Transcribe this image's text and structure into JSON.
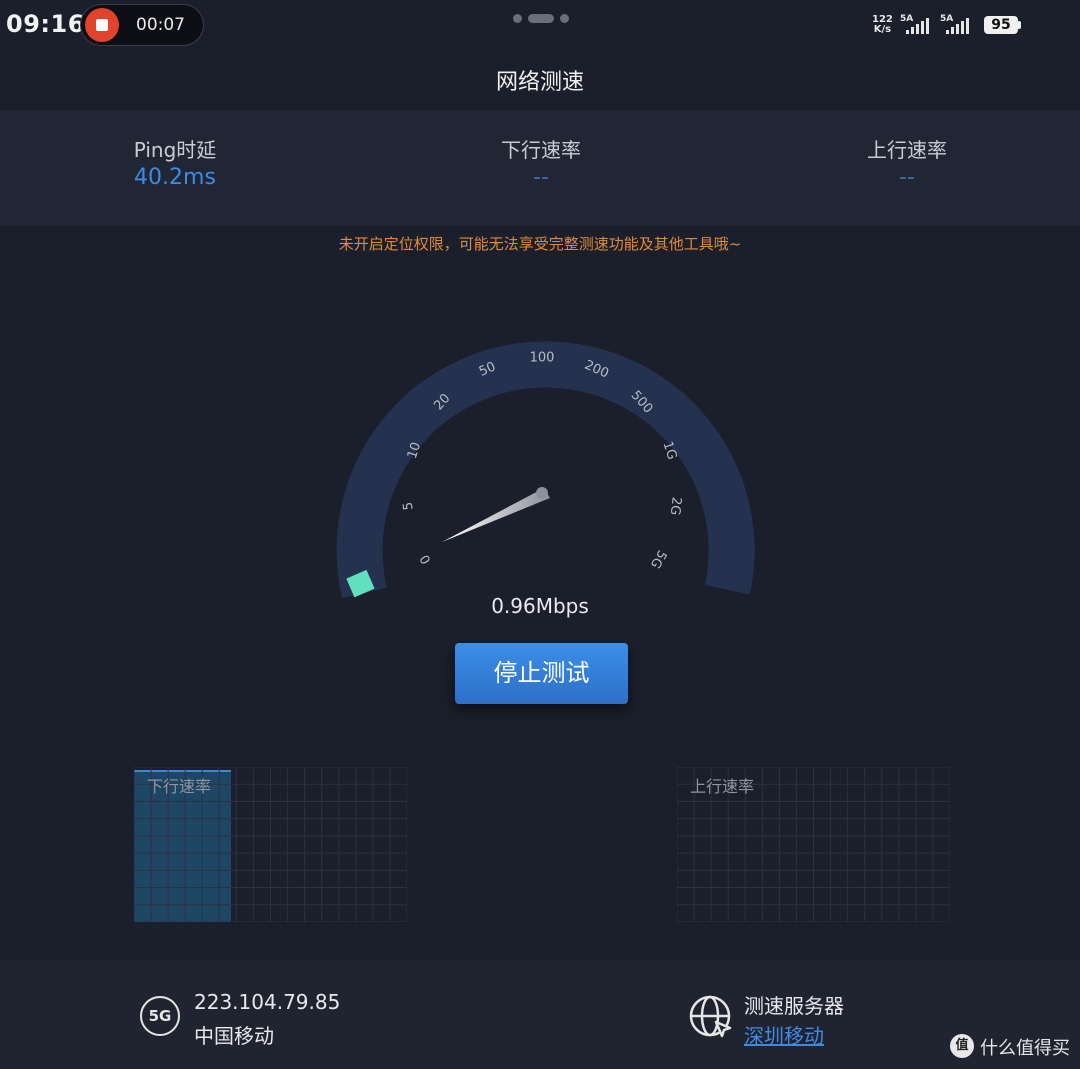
{
  "status_bar": {
    "time": "09:16",
    "recording_time": "00:07",
    "net_speed_value": "122",
    "net_speed_unit": "K/s",
    "signal1": "5A",
    "signal2": "5A",
    "battery": "95"
  },
  "title": "网络测速",
  "stats": {
    "ping_label": "Ping时延",
    "ping_value": "40.2ms",
    "down_label": "下行速率",
    "down_value": "--",
    "up_label": "上行速率",
    "up_value": "--"
  },
  "warning": "未开启定位权限，可能无法享受完整测速功能及其他工具哦~",
  "gauge": {
    "ticks": [
      "0",
      "5",
      "10",
      "20",
      "50",
      "100",
      "200",
      "500",
      "1G",
      "2G",
      "5G"
    ],
    "current_speed": "0.96Mbps"
  },
  "stop_button": "停止测试",
  "graphs": {
    "down_label": "下行速率",
    "up_label": "上行速率"
  },
  "network": {
    "type_icon": "5G",
    "ip": "223.104.79.85",
    "carrier": "中国移动"
  },
  "server": {
    "label": "测速服务器",
    "name": "深圳移动"
  },
  "watermark": {
    "logo": "值",
    "text": "什么值得买"
  },
  "colors": {
    "accent": "#3d8be6",
    "warning": "#e08a3b",
    "progress": "#5fe0bf",
    "recording": "#e2432c"
  }
}
